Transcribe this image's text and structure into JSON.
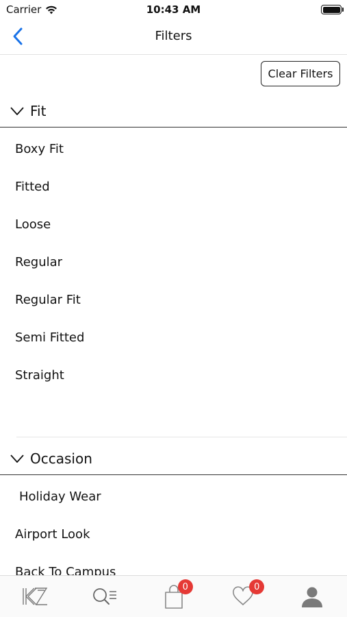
{
  "status_bar": {
    "carrier": "Carrier",
    "time": "10:43 AM"
  },
  "nav": {
    "title": "Filters",
    "back_icon": "chevron-left-icon",
    "accent_color": "#1a73e8"
  },
  "clear_filters_label": "Clear Filters",
  "sections": [
    {
      "title": "Fit",
      "expanded": true,
      "options": [
        "Boxy Fit",
        "Fitted",
        "Loose",
        "Regular",
        "Regular Fit",
        "Semi Fitted",
        "Straight"
      ]
    },
    {
      "title": "Occasion",
      "expanded": true,
      "options": [
        "Holiday Wear",
        "Airport Look",
        "Back To Campus"
      ]
    }
  ],
  "tab_bar": {
    "tabs": [
      {
        "name": "home",
        "icon": "brand-logo-icon"
      },
      {
        "name": "search",
        "icon": "search-menu-icon"
      },
      {
        "name": "bag",
        "icon": "shopping-bag-icon",
        "badge": "0"
      },
      {
        "name": "wishlist",
        "icon": "heart-icon",
        "badge": "0"
      },
      {
        "name": "profile",
        "icon": "user-icon"
      }
    ],
    "badge_color": "#e53935"
  }
}
